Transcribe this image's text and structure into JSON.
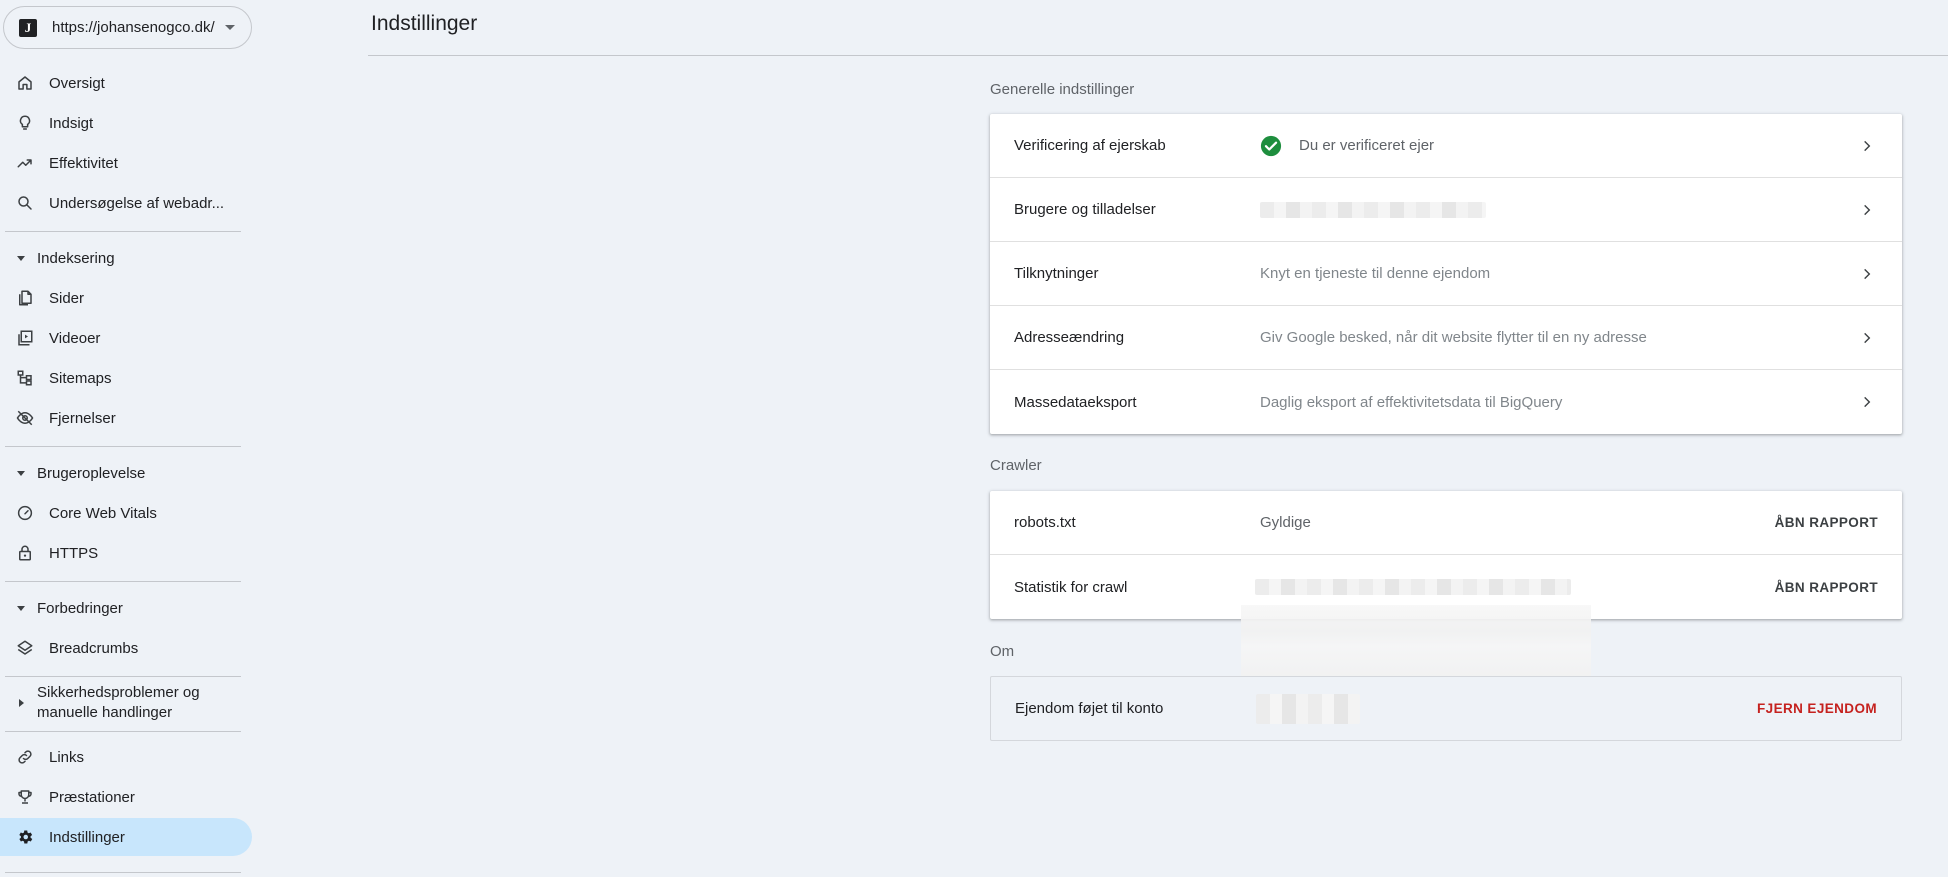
{
  "property": {
    "logo_letter": "J",
    "url": "https://johansenogco.dk/"
  },
  "page_title": "Indstillinger",
  "nav": {
    "overview": "Oversigt",
    "insights": "Indsigt",
    "performance": "Effektivitet",
    "url_inspection": "Undersøgelse af webadr...",
    "indexing_header": "Indeksering",
    "pages": "Sider",
    "videos": "Videoer",
    "sitemaps": "Sitemaps",
    "removals": "Fjernelser",
    "experience_header": "Brugeroplevelse",
    "cwv": "Core Web Vitals",
    "https": "HTTPS",
    "enhancements_header": "Forbedringer",
    "breadcrumbs": "Breadcrumbs",
    "security_header": "Sikkerhedsproblemer og manuelle handlinger",
    "links": "Links",
    "achievements": "Præstationer",
    "settings": "Indstillinger"
  },
  "general": {
    "label": "Generelle indstillinger",
    "rows": [
      {
        "title": "Verificering af ejerskab",
        "value": "Du er verificeret ejer"
      },
      {
        "title": "Brugere og tilladelser",
        "value": ""
      },
      {
        "title": "Tilknytninger",
        "value": "Knyt en tjeneste til denne ejendom"
      },
      {
        "title": "Adresseændring",
        "value": "Giv Google besked, når dit website flytter til en ny adresse"
      },
      {
        "title": "Massedataeksport",
        "value": "Daglig eksport af effektivitetsdata til BigQuery"
      }
    ]
  },
  "crawler": {
    "label": "Crawler",
    "rows": [
      {
        "title": "robots.txt",
        "value": "Gyldige",
        "action": "ÅBN RAPPORT"
      },
      {
        "title": "Statistik for crawl",
        "value": "",
        "action": "ÅBN RAPPORT"
      }
    ]
  },
  "about": {
    "label": "Om",
    "row": {
      "title": "Ejendom føjet til konto",
      "action": "FJERN EJENDOM"
    }
  },
  "colors": {
    "active_nav": "#c8e6fc",
    "verified_green": "#1e8e3e",
    "danger": "#c5221f"
  }
}
